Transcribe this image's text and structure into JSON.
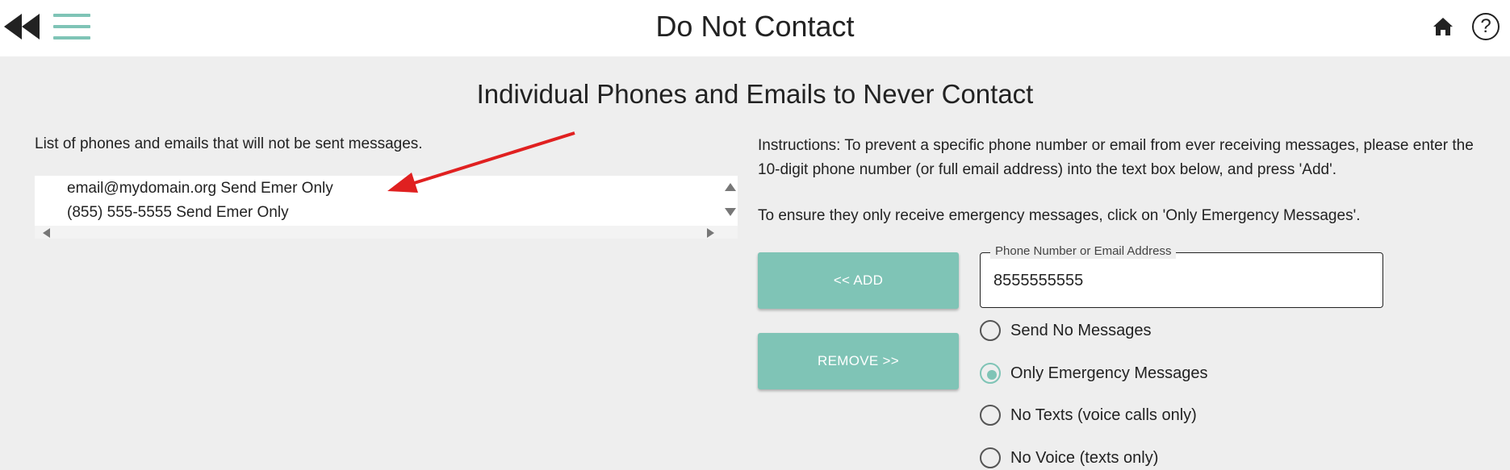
{
  "header": {
    "title": "Do Not Contact",
    "icons": [
      "back-icon",
      "menu-icon",
      "home-icon",
      "help-icon"
    ],
    "help_glyph": "?"
  },
  "section": {
    "title": "Individual Phones and Emails to Never Contact"
  },
  "list": {
    "caption": "List of phones and emails that will not be sent messages.",
    "items": [
      "email@mydomain.org Send Emer Only",
      "(855) 555-5555 Send Emer Only"
    ]
  },
  "instructions": {
    "line1": "Instructions: To prevent a specific phone number or email from ever receiving messages, please enter the 10-digit phone number (or full email address) into the text box below, and press 'Add'.",
    "line2": "To ensure they only receive emergency messages, click on 'Only Emergency Messages'."
  },
  "buttons": {
    "add_label": "<< ADD",
    "remove_label": "REMOVE >>"
  },
  "input": {
    "label": "Phone Number or Email Address",
    "value": "8555555555"
  },
  "options": [
    {
      "label": "Send No Messages",
      "selected": false
    },
    {
      "label": "Only Emergency Messages",
      "selected": true
    },
    {
      "label": "No Texts (voice calls only)",
      "selected": false
    },
    {
      "label": "No Voice (texts only)",
      "selected": false
    }
  ],
  "colors": {
    "accent": "#7fc4b6",
    "annotation_arrow": "#e02020",
    "background": "#eeeeee"
  }
}
